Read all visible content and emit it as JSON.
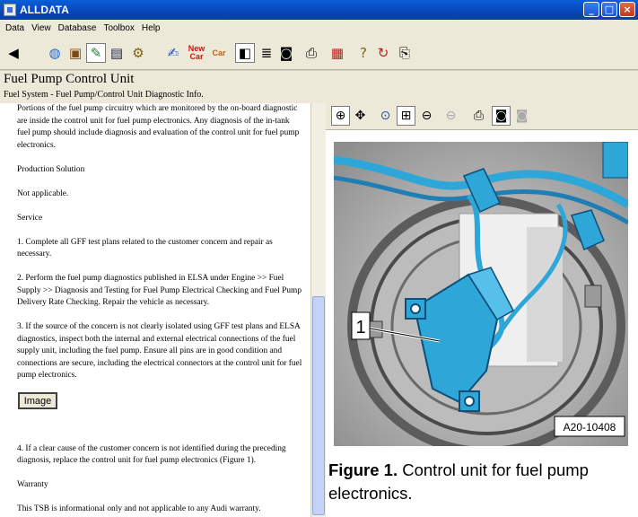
{
  "window": {
    "title": "ALLDATA"
  },
  "menu": [
    "Data",
    "View",
    "Database",
    "Toolbox",
    "Help"
  ],
  "toolbar_icons": [
    "back-arrow-icon",
    "globe-icon",
    "briefcase-icon",
    "vehicle-select-icon",
    "tsb-icon",
    "tools-icon",
    "search-icon",
    "new-car-icon",
    "used-car-icon",
    "split-view-icon",
    "document-icon",
    "camera-icon",
    "print-icon",
    "note-icon",
    "help-icon",
    "refresh-icon",
    "printer-setup-icon"
  ],
  "toolbar_labels": {
    "new_car": "New Car",
    "used_car": "Car"
  },
  "header": {
    "title": "Fuel Pump Control Unit",
    "breadcrumb": "Fuel System - Fuel Pump/Control Unit Diagnostic Info."
  },
  "document": {
    "p1": "Portions of the fuel pump circuitry which are monitored by the on-board diagnostic are inside the control unit for fuel pump electronics. Any diagnosis of the in-tank fuel pump should include diagnosis and evaluation of the control unit for fuel pump electronics.",
    "h_production": "Production Solution",
    "p_na": "Not applicable.",
    "h_service": "Service",
    "s1": "1. Complete all GFF test plans related to the customer concern and repair as necessary.",
    "s2": "2. Perform the fuel pump diagnostics published in ELSA under Engine >> Fuel Supply >> Diagnosis and Testing for Fuel Pump Electrical Checking and Fuel Pump Delivery Rate Checking. Repair the vehicle as necessary.",
    "s3": "3. If the source of the concern is not clearly isolated using GFF test plans and ELSA diagnostics, inspect both the internal and external electrical connections of the fuel supply unit, including the fuel pump. Ensure all pins are in good condition and connections are secure, including the electrical connectors at the control unit for fuel pump electronics.",
    "image_button": "Image",
    "s4": "4. If a clear cause of the customer concern is not identified during the preceding diagnosis, replace the control unit for fuel pump electronics (Figure 1).",
    "h_warranty": "Warranty",
    "p_warranty": "This TSB is informational only and not applicable to any Audi warranty."
  },
  "viewer_icons": [
    "zoom-in-icon",
    "pan-icon",
    "zoom-100-icon",
    "zoom-box-icon",
    "zoom-out-icon",
    "zoom-disabled-icon",
    "print-icon",
    "camera-icon",
    "camera-disabled-icon"
  ],
  "figure": {
    "callout": "1",
    "code": "A20-10408",
    "caption_bold": "Figure 1.",
    "caption_text": " Control unit for fuel pump electronics."
  },
  "colors": {
    "title_bar": "#0745b8",
    "chrome": "#ece9d8",
    "part_blue": "#2ea6d8"
  }
}
